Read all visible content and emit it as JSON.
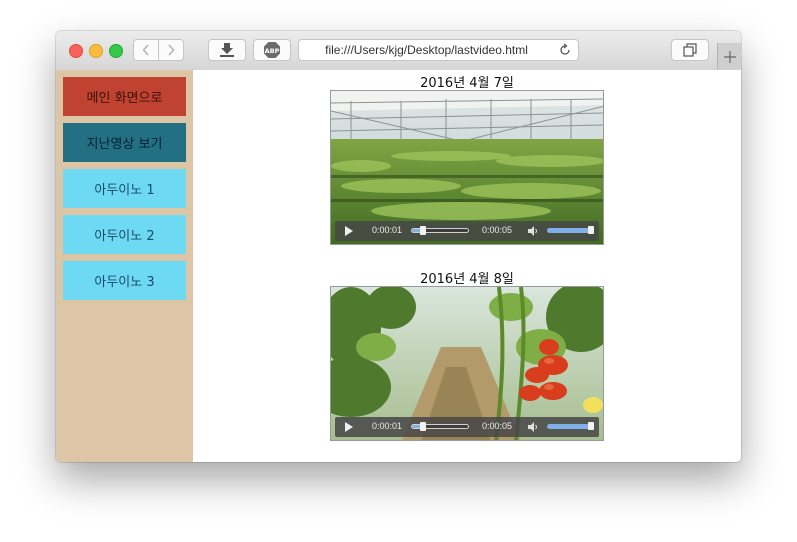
{
  "browser": {
    "url": "file:///Users/kjg/Desktop/lastvideo.html"
  },
  "sidebar": {
    "home_label": "메인 화면으로",
    "past_label": "지난영상 보기",
    "items": [
      "아두이노 1",
      "아두이노 2",
      "아두이노 3"
    ]
  },
  "videos": [
    {
      "date": "2016년 4월 7일",
      "current_time": "0:00:01",
      "duration": "0:00:05",
      "progress": 0.2
    },
    {
      "date": "2016년 4월 8일",
      "current_time": "0:00:01",
      "duration": "0:00:05",
      "progress": 0.2
    }
  ],
  "colors": {
    "sidebar_bg": "#dcc6a6",
    "home_button": "#c04332",
    "past_button": "#236f83",
    "arduino_button": "#6dd9f3"
  }
}
